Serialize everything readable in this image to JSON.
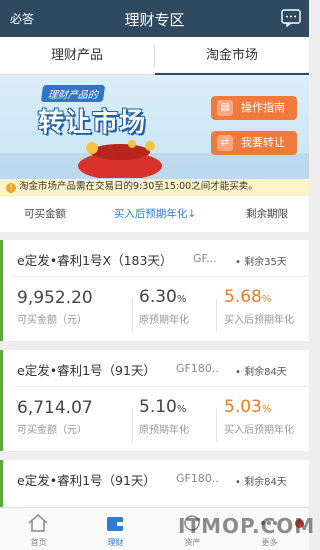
{
  "header": {
    "faq": "必答",
    "title": "理财专区",
    "icon": "message-icon"
  },
  "tabs": [
    {
      "label": "理财产品"
    },
    {
      "label": "淘金市场"
    }
  ],
  "banner": {
    "tag": "理财产品的",
    "headline": "转让市场",
    "guide_button": "操作指南",
    "transfer_button": "我要转让"
  },
  "notice": "淘金市场产品需在交易日的9:30至15:00之间才能买卖。",
  "sort": {
    "available": "可买金额",
    "rate": "买入后预期年化↓",
    "remaining": "剩余期限"
  },
  "products": [
    {
      "name": "e定发•睿利1号X（183天）",
      "code": "GF...",
      "remaining": "剩余35天",
      "amount": "9,952.20",
      "amount_label": "可买金额（元）",
      "rate": "6.30",
      "rate_label": "原预期年化",
      "buy_rate": "5.68",
      "buy_rate_label": "买入后预期年化"
    },
    {
      "name": "e定发•睿利1号（91天）",
      "code": "GF180...",
      "remaining": "剩余84天",
      "amount": "6,714.07",
      "amount_label": "可买金额（元）",
      "rate": "5.10",
      "rate_label": "原预期年化",
      "buy_rate": "5.03",
      "buy_rate_label": "买入后预期年化"
    },
    {
      "name": "e定发•睿利1号（91天）",
      "code": "GF180...",
      "remaining": "剩余84天"
    }
  ],
  "percent": "%",
  "nav": [
    {
      "label": "首页"
    },
    {
      "label": "理财"
    },
    {
      "label": "资产"
    },
    {
      "label": "更多"
    }
  ],
  "watermark": "ITMOP.COM",
  "colors": {
    "header": "#2f4960",
    "accent": "#2a7fd4",
    "orange": "#f07a1e",
    "card_border": "#5aac3a"
  }
}
